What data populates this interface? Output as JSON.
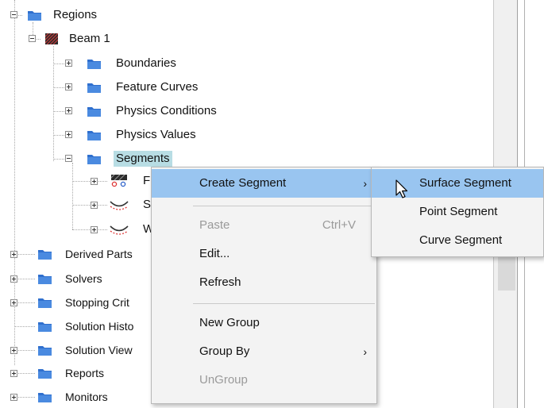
{
  "tree": {
    "regions_label": "Regions",
    "beam_label": "Beam 1",
    "boundaries_label": "Boundaries",
    "feature_curves_label": "Feature Curves",
    "physics_conditions_label": "Physics Conditions",
    "physics_values_label": "Physics Values",
    "segments_label": "Segments",
    "child_1_label": "F",
    "child_2_label": "S",
    "child_3_label": "W",
    "derived_parts_label": "Derived Parts",
    "solvers_label": "Solvers",
    "stopping_criteria_label": "Stopping Crit",
    "solution_history_label": "Solution Histo",
    "solution_views_label": "Solution View",
    "reports_label": "Reports",
    "monitors_label": "Monitors"
  },
  "context_menu": {
    "create_segment": "Create Segment",
    "paste": "Paste",
    "paste_shortcut": "Ctrl+V",
    "edit": "Edit...",
    "refresh": "Refresh",
    "new_group": "New Group",
    "group_by": "Group By",
    "ungroup": "UnGroup"
  },
  "submenu": {
    "surface_segment": "Surface Segment",
    "point_segment": "Point Segment",
    "curve_segment": "Curve Segment"
  },
  "colors": {
    "selection_bg": "#b8dde4",
    "menu_highlight": "#99c5f0",
    "folder_blue": "#2f6fce",
    "menu_bg": "#f3f3f3"
  }
}
